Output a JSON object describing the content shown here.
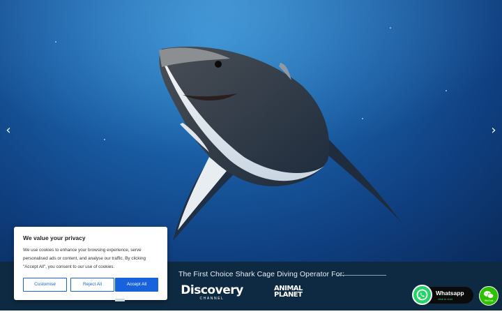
{
  "slider": {
    "prev_icon": "chevron-left-icon",
    "next_icon": "chevron-right-icon",
    "prev_glyph": "‹",
    "next_glyph": "›"
  },
  "band": {
    "title": "The First Choice Shark Cage Diving Operator For:",
    "logos": {
      "discovery_main": "Discovery",
      "discovery_sub": "CHANNEL",
      "animal_planet_line1": "ANIMAL",
      "animal_planet_line2": "PLANET"
    }
  },
  "cookie_banner": {
    "title": "We value your privacy",
    "body": "We use cookies to enhance your browsing experience, serve personalised ads or content, and analyse our traffic. By clicking \"Accept All\", you consent to our use of cookies.",
    "customise_label": "Customise",
    "reject_label": "Reject All",
    "accept_label": "Accept All",
    "accent_color": "#1863dc"
  },
  "chat": {
    "whatsapp_title": "Whatsapp",
    "whatsapp_sub": "click to chat",
    "wechat_label": "WeChat"
  }
}
